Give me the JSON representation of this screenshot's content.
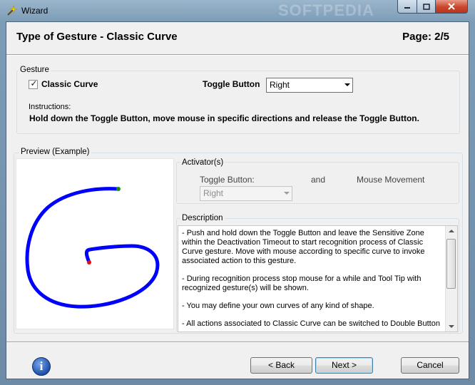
{
  "window": {
    "title": "Wizard",
    "watermark": "SOFTPEDIA",
    "controls": {
      "minimize": "–",
      "maximize": "□",
      "close": "✕"
    }
  },
  "header": {
    "title": "Type of Gesture - Classic Curve",
    "page": "Page: 2/5"
  },
  "gesture": {
    "group_label": "Gesture",
    "classic_curve_label": "Classic Curve",
    "classic_curve_checked": true,
    "toggle_button_label": "Toggle Button",
    "toggle_button_value": "Right",
    "instructions_label": "Instructions:",
    "instructions_text": "Hold down the Toggle Button, move mouse in specific directions and release the Toggle Button."
  },
  "preview": {
    "group_label": "Preview (Example)",
    "curve_color": "#0000ff",
    "start_dot_color": "#1a8a1a",
    "end_dot_color": "#e01010"
  },
  "activator": {
    "group_label": "Activator(s)",
    "toggle_label": "Toggle Button:",
    "and_label": "and",
    "movement_label": "Mouse Movement",
    "toggle_value": "Right"
  },
  "description": {
    "group_label": "Description",
    "paragraphs": [
      "- Push and hold down the Toggle Button and leave the Sensitive Zone within the Deactivation Timeout to start recognition process of Classic Curve gesture. Move with mouse according to specific curve to invoke associated action to this gesture.",
      "- During recognition process stop mouse for a while and Tool Tip with recognized gesture(s) will be shown.",
      "- You may define your own curves of any kind of shape.",
      "- All actions associated to Classic Curve can be switched to Double Button"
    ]
  },
  "footer": {
    "back_label": "< Back",
    "next_label": "Next >",
    "cancel_label": "Cancel",
    "info_glyph": "i"
  }
}
